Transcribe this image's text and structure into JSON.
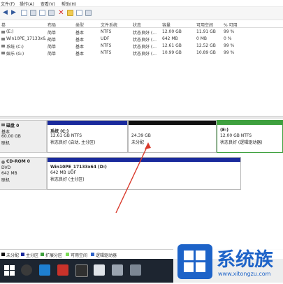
{
  "menu": [
    "文件(F)",
    "操作(A)",
    "查看(V)",
    "帮助(H)"
  ],
  "table": {
    "columns": [
      "卷",
      "布局",
      "类型",
      "文件系统",
      "状态",
      "容量",
      "可用空间",
      "% 可用"
    ],
    "rows": [
      [
        "(E:)",
        "简单",
        "基本",
        "NTFS",
        "状态良好 (...",
        "12.00 GB",
        "11.91 GB",
        "99 %"
      ],
      [
        "Win10PE_17133x6...",
        "简单",
        "基本",
        "UDF",
        "状态良好 (...",
        "642 MB",
        "0 MB",
        "0 %"
      ],
      [
        "系统 (C:)",
        "简单",
        "基本",
        "NTFS",
        "状态良好 (...",
        "12.61 GB",
        "12.52 GB",
        "99 %"
      ],
      [
        "娱乐 (G:)",
        "简单",
        "基本",
        "NTFS",
        "状态良好 (...",
        "10.99 GB",
        "10.89 GB",
        "99 %"
      ]
    ]
  },
  "disk0": {
    "label": "磁盘 0",
    "type": "基本",
    "size": "60.00 GB",
    "status": "联机",
    "partitions": [
      {
        "name": "系统 (C:)",
        "info": "12.61 GB NTFS",
        "status": "状态良好 (启动, 主分区)"
      },
      {
        "name": "",
        "info": "24.39 GB",
        "status": "未分配"
      },
      {
        "name": "(E:)",
        "info": "12.00 GB NTFS",
        "status": "状态良好 (逻辑驱动器)"
      }
    ]
  },
  "cdrom0": {
    "label": "CD-ROM 0",
    "type": "DVD",
    "size": "642 MB",
    "status": "联机",
    "partition": {
      "name": "Win10PE_17133x64 (D:)",
      "info": "642 MB UDF",
      "status": "状态良好 (主分区)"
    }
  },
  "legend": [
    "未分配",
    "主分区",
    "扩展分区",
    "可用空间",
    "逻辑驱动器"
  ],
  "legend_colors": [
    "#111111",
    "#1a2a9c",
    "#3ea03e",
    "#7ddc58",
    "#2f63c8"
  ],
  "watermark": {
    "brand": "系统族",
    "url": "www.xitongzu.com"
  }
}
